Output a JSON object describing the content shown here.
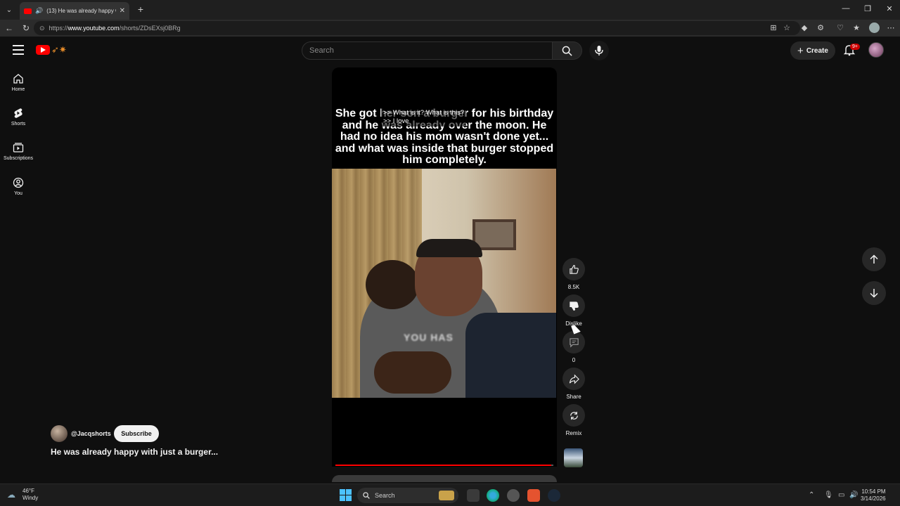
{
  "browser": {
    "tab_title": "(13) He was already happy wi",
    "url_prefix": "https://",
    "url_host": "www.youtube.com",
    "url_path": "/shorts/ZDsEXsj0BRg"
  },
  "header": {
    "search_placeholder": "Search",
    "create_label": "Create",
    "notification_count": "9+"
  },
  "sidebar": {
    "items": [
      {
        "label": "Home",
        "icon": "home-icon"
      },
      {
        "label": "Shorts",
        "icon": "shorts-icon"
      },
      {
        "label": "Subscriptions",
        "icon": "subscriptions-icon"
      },
      {
        "label": "You",
        "icon": "you-icon"
      }
    ]
  },
  "video": {
    "caption": "She got her son a burger for his birthday and he was already over the moon. He had no idea his mom wasn't done yet... and what was inside that burger stopped him completely.",
    "subtitle_line1": ">> What is it? What is this?",
    "subtitle_line2": ">> I love",
    "overlay_word": "YOU HAS",
    "progress_fraction": 0.99
  },
  "actions": {
    "like_count": "8.5K",
    "dislike_label": "Dislike",
    "comment_count": "0",
    "share_label": "Share",
    "remix_label": "Remix"
  },
  "channel": {
    "handle": "@Jacqshorts",
    "subscribe_label": "Subscribe",
    "video_title": "He was already happy with just a burger..."
  },
  "taskbar": {
    "temperature": "46°F",
    "weather": "Windy",
    "search_label": "Search",
    "time": "10:54 PM",
    "date": "3/14/2026"
  },
  "colors": {
    "background": "#0f0f0f",
    "brand_red": "#ff0000",
    "chip": "#272727"
  }
}
